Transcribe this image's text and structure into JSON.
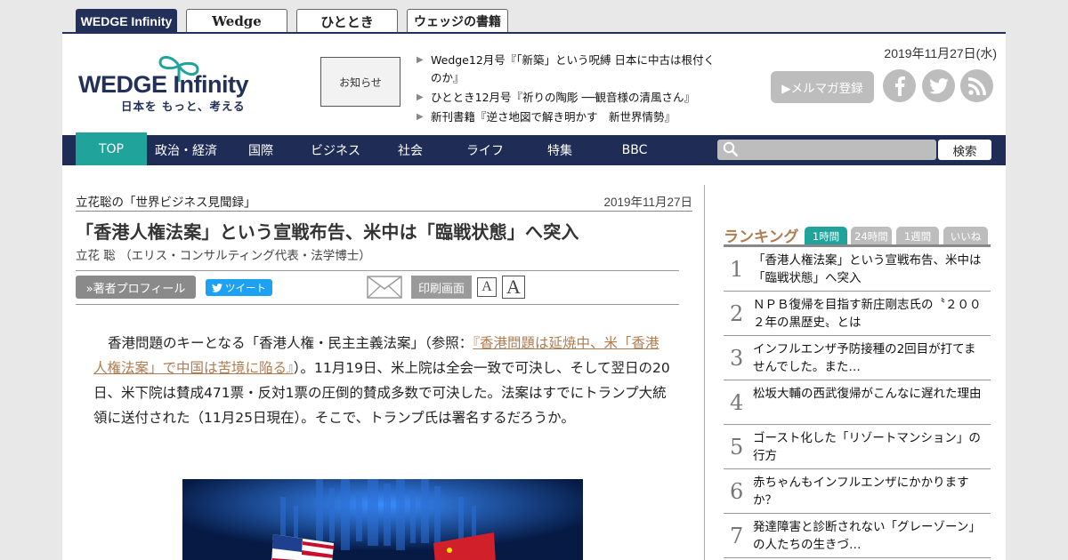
{
  "site_tabs": [
    "WEDGE Infinity",
    "Wedge",
    "ひととき",
    "ウェッジの書籍"
  ],
  "logo": {
    "wordmark_left": "WEDGE",
    "wordmark_right": "Infinity",
    "tagline": "日本を もっと、考える"
  },
  "notice_label": "お知らせ",
  "news": [
    "Wedge12月号『「新築」という呪縛 日本に中古は根付くのか』",
    "ひととき12月号『祈りの陶彫 ──観音様の清風さん』",
    "新刊書籍『逆さ地図で解き明かす　新世界情勢』"
  ],
  "header_date": "2019年11月27日(水)",
  "mail_magazine_label": "▶メルマガ登録",
  "social": {
    "facebook": "f",
    "twitter": "t",
    "rss": "rss"
  },
  "nav": [
    "TOP",
    "政治・経済",
    "国際",
    "ビジネス",
    "社会",
    "ライフ",
    "特集",
    "BBC"
  ],
  "search": {
    "placeholder": "",
    "button": "検索"
  },
  "article": {
    "series": "立花聡の「世界ビジネス見聞録」",
    "date": "2019年11月27日",
    "headline": "「香港人権法案」という宣戦布告、米中は「臨戦状態」へ突入",
    "byline": "立花 聡 （エリス・コンサルティング代表・法学博士）",
    "profile_button": "»著者プロフィール",
    "tweet_button": "ツイート",
    "print_button": "印刷画面",
    "font_small": "A",
    "font_large": "A",
    "body_before": "香港問題のキーとなる「香港人権・民主主義法案」（参照：",
    "body_link": "『香港問題は延焼中、米「香港人権法案」で中国は苦境に陥る』",
    "body_after": "）。11月19日、米上院は全会一致で可決し、そして翌日の20日、米下院は賛成471票・反対1票の圧倒的賛成多数で可決した。法案はすでにトランプ大統領に送付された（11月25日現在）。そこで、トランプ氏は署名するだろうか。"
  },
  "ranking": {
    "title": "ランキング",
    "tabs": [
      "1時間",
      "24時間",
      "1週間",
      "いいね"
    ],
    "items": [
      {
        "rank": "1",
        "title": "「香港人権法案」という宣戦布告、米中は「臨戦状態」へ突入"
      },
      {
        "rank": "2",
        "title": "ＮＰＢ復帰を目指す新庄剛志氏の〝２００２年の黒歴史〟とは"
      },
      {
        "rank": "3",
        "title": "インフルエンザ予防接種の2回目が打てませんでした。また…"
      },
      {
        "rank": "4",
        "title": "松坂大輔の西武復帰がこんなに遅れた理由"
      },
      {
        "rank": "5",
        "title": "ゴースト化した「リゾートマンション」の行方"
      },
      {
        "rank": "6",
        "title": "赤ちゃんもインフルエンザにかかりますか？"
      },
      {
        "rank": "7",
        "title": "発達障害と診断されない「グレーゾーン」の人たちの生きづ…"
      }
    ]
  }
}
